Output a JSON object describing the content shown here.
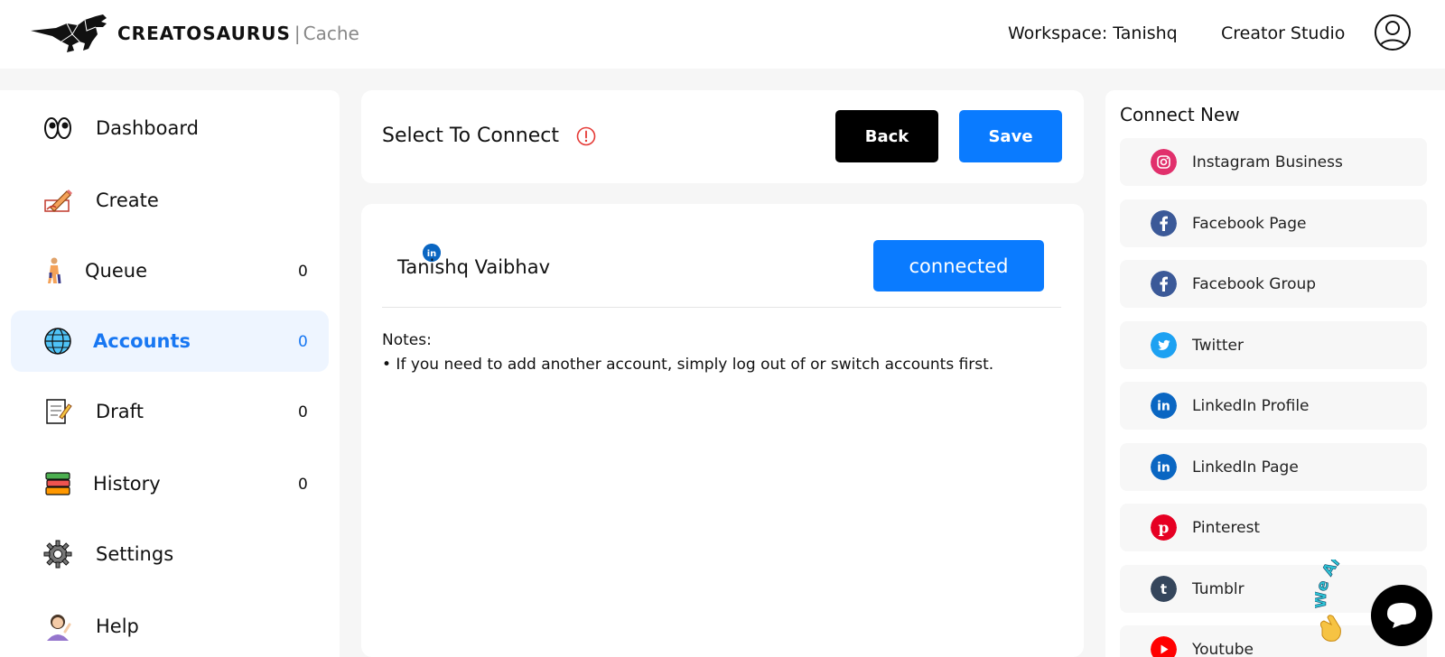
{
  "header": {
    "brand_main": "CREATOSAURUS",
    "brand_separator": "|",
    "brand_sub": "Cache",
    "workspace": "Workspace: Tanishq",
    "studio": "Creator Studio",
    "avatar_icon": "user-circle-icon"
  },
  "sidebar": {
    "items": [
      {
        "label": "Dashboard",
        "icon": "eyes-icon",
        "count": ""
      },
      {
        "label": "Create",
        "icon": "pencil-writing-icon",
        "count": ""
      },
      {
        "label": "Queue",
        "icon": "person-walking-icon",
        "count": "0"
      },
      {
        "label": "Accounts",
        "icon": "globe-icon",
        "count": "0",
        "active": true
      },
      {
        "label": "Draft",
        "icon": "memo-icon",
        "count": "0"
      },
      {
        "label": "History",
        "icon": "books-icon",
        "count": "0"
      },
      {
        "label": "Settings",
        "icon": "gear-icon",
        "count": ""
      },
      {
        "label": "Help",
        "icon": "person-tipping-hand-icon",
        "count": ""
      }
    ]
  },
  "main": {
    "title": "Select To Connect",
    "info_icon": "exclamation-circle-icon",
    "back_label": "Back",
    "save_label": "Save",
    "account": {
      "name": "Tanishq Vaibhav",
      "platform_badge": "linkedin-icon",
      "status_label": "connected"
    },
    "notes_label": "Notes:",
    "notes_text": "• If you need to add another account, simply log out of or switch accounts first."
  },
  "connect_new": {
    "title": "Connect New",
    "platforms": [
      {
        "label": "Instagram Business",
        "icon": "instagram-icon",
        "color": "#e1306c"
      },
      {
        "label": "Facebook Page",
        "icon": "facebook-icon",
        "color": "#3b5998"
      },
      {
        "label": "Facebook Group",
        "icon": "facebook-icon",
        "color": "#3b5998"
      },
      {
        "label": "Twitter",
        "icon": "twitter-icon",
        "color": "#1da1f2"
      },
      {
        "label": "LinkedIn Profile",
        "icon": "linkedin-icon",
        "color": "#0a66c2"
      },
      {
        "label": "LinkedIn Page",
        "icon": "linkedin-icon",
        "color": "#0a66c2"
      },
      {
        "label": "Pinterest",
        "icon": "pinterest-icon",
        "color": "#e60023"
      },
      {
        "label": "Tumblr",
        "icon": "tumblr-icon",
        "color": "#35465c"
      },
      {
        "label": "Youtube",
        "icon": "youtube-icon",
        "color": "#ff0000"
      }
    ]
  },
  "chat_widget": {
    "tagline": "We Are Here!",
    "icon": "chat-bubble-icon",
    "wave_icon": "waving-hand-icon"
  },
  "colors": {
    "accent": "#0a7bff",
    "active_bg": "#eef5ff",
    "page_bg": "#f6f6f6"
  }
}
